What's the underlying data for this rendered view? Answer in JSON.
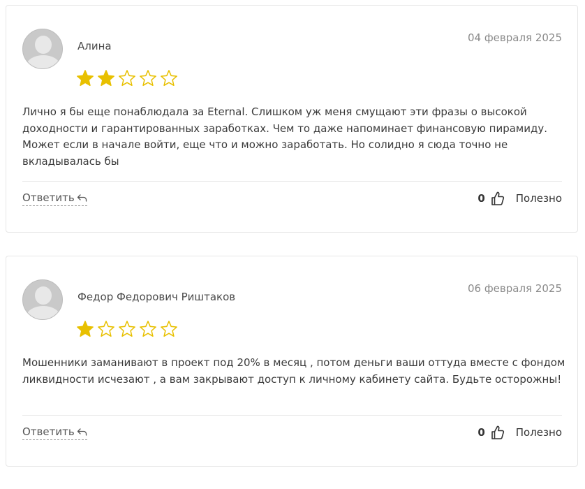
{
  "colors": {
    "star_filled": "#e8c000",
    "star_outline": "#e8c000",
    "avatar_bg": "#c9c9c9"
  },
  "reviews": [
    {
      "author": "Алина",
      "date": "04 февраля 2025",
      "rating": 2,
      "rating_max": 5,
      "text": "Лично я бы еще понаблюдала за Eternal. Слишком уж меня смущают эти фразы о высокой доходности и гарантированных заработках. Чем то даже напоминает финансовую пирамиду. Может если в начале войти, еще что и можно заработать. Но солидно я сюда точно не вкладывалась бы",
      "reply_label": "Ответить",
      "helpful_count": "0",
      "helpful_label": "Полезно"
    },
    {
      "author": "Федор Федорович Риштаков",
      "date": "06 февраля 2025",
      "rating": 1,
      "rating_max": 5,
      "text": "Мошенники заманивают в проект под 20% в месяц , потом деньги ваши оттуда вместе с фондом ликвидности исчезают , а вам закрывают доступ к личному кабинету сайта. Будьте осторожны!",
      "reply_label": "Ответить",
      "helpful_count": "0",
      "helpful_label": "Полезно"
    }
  ]
}
